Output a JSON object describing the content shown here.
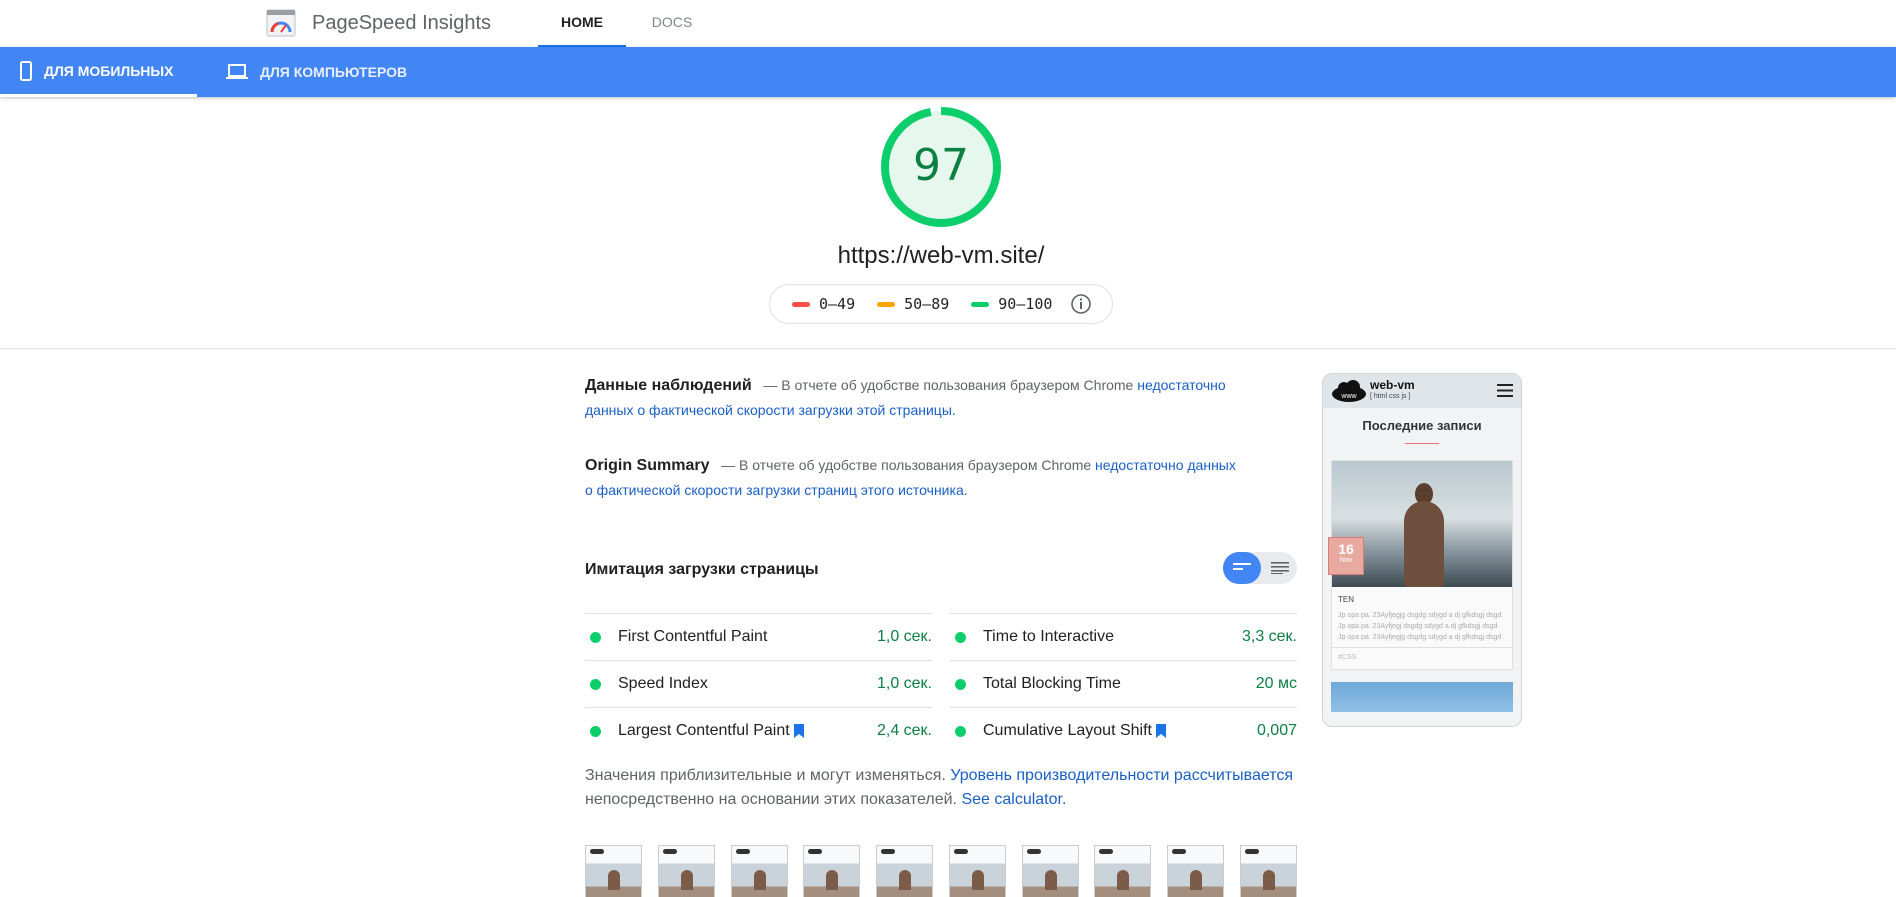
{
  "app": {
    "name": "PageSpeed Insights",
    "nav": {
      "home": "HOME",
      "docs": "DOCS"
    }
  },
  "device_tabs": {
    "mobile": "ДЛЯ МОБИЛЬНЫХ",
    "desktop": "ДЛЯ КОМПЬЮТЕРОВ"
  },
  "score": {
    "value": "97",
    "fraction": 0.97,
    "color": "#0cce6b"
  },
  "url": "https://web-vm.site/",
  "legend": [
    {
      "range": "0–49",
      "color": "#ff4e42"
    },
    {
      "range": "50–89",
      "color": "#ffa400"
    },
    {
      "range": "90–100",
      "color": "#0cce6b"
    }
  ],
  "field_data": {
    "title": "Данные наблюдений",
    "text": "— В отчете об удобстве пользования браузером Chrome",
    "link": "недостаточно данных о фактической скорости загрузки этой страницы."
  },
  "origin_summary": {
    "title": "Origin Summary",
    "text": "— В отчете об удобстве пользования браузером Chrome",
    "link": "недостаточно данных о фактической скорости загрузки страниц этого источника."
  },
  "lab": {
    "title": "Имитация загрузки страницы",
    "metrics": [
      {
        "name": "First Contentful Paint",
        "value": "1,0 сек.",
        "flag": false
      },
      {
        "name": "Time to Interactive",
        "value": "3,3 сек.",
        "flag": false
      },
      {
        "name": "Speed Index",
        "value": "1,0 сек.",
        "flag": false
      },
      {
        "name": "Total Blocking Time",
        "value": "20 мс",
        "flag": false
      },
      {
        "name": "Largest Contentful Paint",
        "value": "2,4 сек.",
        "flag": true
      },
      {
        "name": "Cumulative Layout Shift",
        "value": "0,007",
        "flag": true
      }
    ]
  },
  "note": {
    "text1": "Значения приблизительные и могут изменяться.",
    "link1": "Уровень производительности рассчитывается",
    "text2": "непосредственно на основании этих показателей.",
    "link2": "See calculator."
  },
  "thumbnail_count": 10,
  "preview": {
    "site_name": "web-vm",
    "site_sub": "[ html css js ]",
    "logo_text": "www",
    "heading": "Последние записи",
    "date_day": "16",
    "date_month": "Nov",
    "card_title": "TEN",
    "card_text": "Jp opa pa. 23Ayfjegjg dsgdg sdygd a dj gfkdsgj dsgd. Jp opa pa. 23Ayfjegj dsgdg sdygd a dj gfkdsgj dsgd. Jp opa pa. 23Ayfjegjg dsgdg sdygd a dj gfkdsgj dsgd",
    "card_foot": "#CSS"
  }
}
